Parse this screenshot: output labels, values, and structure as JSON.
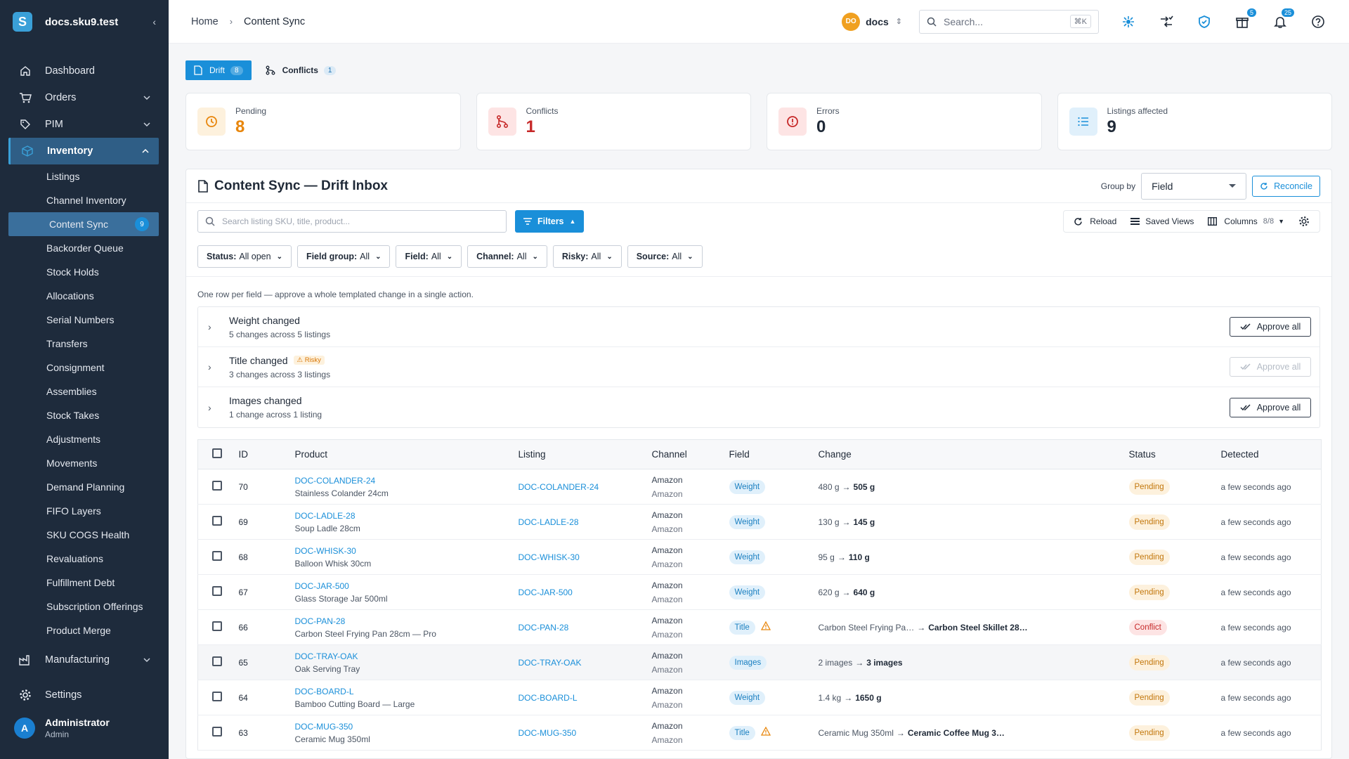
{
  "sidebar": {
    "brand": "docs.sku9.test",
    "brand_logo": "S",
    "collapse_icon": "chevron-left-icon",
    "items": [
      {
        "label": "Dashboard",
        "icon": "home-icon"
      },
      {
        "label": "Orders",
        "icon": "cart-icon"
      },
      {
        "label": "PIM",
        "icon": "tag-icon"
      },
      {
        "label": "Inventory",
        "icon": "box-icon"
      }
    ],
    "inventory_sub": [
      "Listings",
      "Channel Inventory",
      "Content Sync",
      "Backorder Queue",
      "Stock Holds",
      "Allocations",
      "Serial Numbers",
      "Transfers",
      "Consignment",
      "Assemblies",
      "Stock Takes",
      "Adjustments",
      "Movements",
      "Demand Planning",
      "FIFO Layers",
      "SKU COGS Health",
      "Revaluations",
      "Fulfillment Debt",
      "Subscription Offerings",
      "Product Merge"
    ],
    "content_sync_badge": "9",
    "manufacturing": "Manufacturing",
    "settings": "Settings",
    "user": {
      "name": "Administrator",
      "role": "Admin",
      "initial": "A"
    }
  },
  "topbar": {
    "crumb_home": "Home",
    "crumb_sep": "›",
    "crumb_current": "Content Sync",
    "tenant_initials": "DO",
    "tenant_name": "docs",
    "search_placeholder": "Search...",
    "search_kbd": "⌘K",
    "gift_badge": "5",
    "bell_badge": "25"
  },
  "tabs": [
    {
      "label": "Drift",
      "count": "8"
    },
    {
      "label": "Conflicts",
      "count": "1"
    }
  ],
  "stats": [
    {
      "label": "Pending",
      "value": "8",
      "color": "#e8860c"
    },
    {
      "label": "Conflicts",
      "value": "1",
      "color": "#c62828"
    },
    {
      "label": "Errors",
      "value": "0",
      "color": "#1f2937"
    },
    {
      "label": "Listings affected",
      "value": "9",
      "color": "#1f2937"
    }
  ],
  "panel": {
    "title": "Content Sync — Drift Inbox",
    "group_by_label": "Group by",
    "group_by_value": "Field",
    "reconcile": "Reconcile",
    "search_placeholder": "Search listing SKU, title, product...",
    "filters": "Filters",
    "reload": "Reload",
    "saved_views": "Saved Views",
    "columns": "Columns",
    "columns_count": "8/8",
    "chips": [
      {
        "key": "Status:",
        "val": "All open"
      },
      {
        "key": "Field group:",
        "val": "All"
      },
      {
        "key": "Field:",
        "val": "All"
      },
      {
        "key": "Channel:",
        "val": "All"
      },
      {
        "key": "Risky:",
        "val": "All"
      },
      {
        "key": "Source:",
        "val": "All"
      }
    ],
    "hint": "One row per field — approve a whole templated change in a single action.",
    "groups": [
      {
        "title": "Weight changed",
        "sub": "5 changes across 5 listings",
        "risky": "",
        "approve": "Approve all",
        "disabled": false
      },
      {
        "title": "Title changed",
        "sub": "3 changes across 3 listings",
        "risky": "Risky",
        "approve": "Approve all",
        "disabled": true
      },
      {
        "title": "Images changed",
        "sub": "1 change across 1 listing",
        "risky": "",
        "approve": "Approve all",
        "disabled": false
      }
    ],
    "columns_headers": [
      "ID",
      "Product",
      "Listing",
      "Channel",
      "Field",
      "Change",
      "Status",
      "Detected"
    ],
    "rows": [
      {
        "id": "70",
        "sku": "DOC-COLANDER-24",
        "name": "Stainless Colander 24cm",
        "listing": "DOC-COLANDER-24",
        "channel": "Amazon",
        "channel2": "Amazon",
        "field": "Weight",
        "warn": false,
        "from": "480 g",
        "to": "505 g",
        "status": "Pending",
        "detected": "a few seconds ago"
      },
      {
        "id": "69",
        "sku": "DOC-LADLE-28",
        "name": "Soup Ladle 28cm",
        "listing": "DOC-LADLE-28",
        "channel": "Amazon",
        "channel2": "Amazon",
        "field": "Weight",
        "warn": false,
        "from": "130 g",
        "to": "145 g",
        "status": "Pending",
        "detected": "a few seconds ago"
      },
      {
        "id": "68",
        "sku": "DOC-WHISK-30",
        "name": "Balloon Whisk 30cm",
        "listing": "DOC-WHISK-30",
        "channel": "Amazon",
        "channel2": "Amazon",
        "field": "Weight",
        "warn": false,
        "from": "95 g",
        "to": "110 g",
        "status": "Pending",
        "detected": "a few seconds ago"
      },
      {
        "id": "67",
        "sku": "DOC-JAR-500",
        "name": "Glass Storage Jar 500ml",
        "listing": "DOC-JAR-500",
        "channel": "Amazon",
        "channel2": "Amazon",
        "field": "Weight",
        "warn": false,
        "from": "620 g",
        "to": "640 g",
        "status": "Pending",
        "detected": "a few seconds ago"
      },
      {
        "id": "66",
        "sku": "DOC-PAN-28",
        "name": "Carbon Steel Frying Pan 28cm — Pro",
        "listing": "DOC-PAN-28",
        "channel": "Amazon",
        "channel2": "Amazon",
        "field": "Title",
        "warn": true,
        "from": "Carbon Steel Frying Pa…",
        "to": "Carbon Steel Skillet 28…",
        "status": "Conflict",
        "detected": "a few seconds ago"
      },
      {
        "id": "65",
        "sku": "DOC-TRAY-OAK",
        "name": "Oak Serving Tray",
        "listing": "DOC-TRAY-OAK",
        "channel": "Amazon",
        "channel2": "Amazon",
        "field": "Images",
        "warn": false,
        "from": "2 images",
        "to": "3 images",
        "status": "Pending",
        "detected": "a few seconds ago"
      },
      {
        "id": "64",
        "sku": "DOC-BOARD-L",
        "name": "Bamboo Cutting Board — Large",
        "listing": "DOC-BOARD-L",
        "channel": "Amazon",
        "channel2": "Amazon",
        "field": "Weight",
        "warn": false,
        "from": "1.4 kg",
        "to": "1650 g",
        "status": "Pending",
        "detected": "a few seconds ago"
      },
      {
        "id": "63",
        "sku": "DOC-MUG-350",
        "name": "Ceramic Mug 350ml",
        "listing": "DOC-MUG-350",
        "channel": "Amazon",
        "channel2": "Amazon",
        "field": "Title",
        "warn": true,
        "from": "Ceramic Mug 350ml",
        "to": "Ceramic Coffee Mug 3…",
        "status": "Pending",
        "detected": "a few seconds ago"
      }
    ]
  },
  "colors": {
    "accent": "#1a8fd9",
    "sidebar": "#1e2b3c",
    "pending": "#e8860c",
    "conflict": "#c62828"
  }
}
